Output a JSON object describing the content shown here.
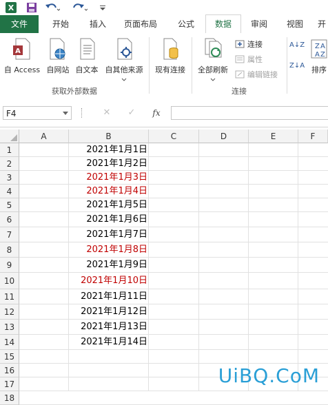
{
  "quick_access": {
    "excel_icon": "excel-logo-icon",
    "save_icon": "save-icon",
    "undo_icon": "undo-icon",
    "redo_icon": "redo-icon",
    "customize_icon": "customize-qat-icon"
  },
  "tabs": {
    "file": "文件",
    "home": "开始",
    "insert": "插入",
    "page_layout": "页面布局",
    "formulas": "公式",
    "data": "数据",
    "review": "审阅",
    "view": "视图",
    "more": "开"
  },
  "ribbon": {
    "from_access": "自 Access",
    "from_web": "自网站",
    "from_text": "自文本",
    "from_other": "自其他来源",
    "existing_connections": "现有连接",
    "refresh_all": "全部刷新",
    "connections": "连接",
    "properties": "属性",
    "edit_links": "编辑链接",
    "sort": "排序",
    "group_external": "获取外部数据",
    "group_connections": "连接",
    "sort_az": "A↓Z",
    "sort_za": "Z↓A"
  },
  "formula_bar": {
    "name_box": "F4",
    "cancel": "✕",
    "enter": "✓",
    "fx": "fx",
    "value": ""
  },
  "grid": {
    "columns": [
      "A",
      "B",
      "C",
      "D",
      "E",
      "F"
    ],
    "rows": [
      "1",
      "2",
      "3",
      "4",
      "5",
      "6",
      "7",
      "8",
      "9",
      "10",
      "11",
      "12",
      "13",
      "14",
      "15",
      "16",
      "17",
      "18"
    ],
    "cells": [
      {
        "text": "2021年1月1日",
        "color": "#000000"
      },
      {
        "text": "2021年1月2日",
        "color": "#000000"
      },
      {
        "text": "2021年1月3日",
        "color": "#c00000"
      },
      {
        "text": "2021年1月4日",
        "color": "#c00000"
      },
      {
        "text": "2021年1月5日",
        "color": "#000000"
      },
      {
        "text": "2021年1月6日",
        "color": "#000000"
      },
      {
        "text": "2021年1月7日",
        "color": "#000000"
      },
      {
        "text": "2021年1月8日",
        "color": "#c00000"
      },
      {
        "text": "2021年1月9日",
        "color": "#000000"
      },
      {
        "text": "2021年1月10日",
        "color": "#c00000"
      },
      {
        "text": "2021年1月11日",
        "color": "#000000"
      },
      {
        "text": "2021年1月12日",
        "color": "#000000"
      },
      {
        "text": "2021年1月13日",
        "color": "#000000"
      },
      {
        "text": "2021年1月14日",
        "color": "#000000"
      }
    ]
  },
  "watermark": "UiBQ.CoM",
  "colors": {
    "excel_green": "#217346",
    "red_date": "#c00000",
    "watermark": "#2a9fd6"
  }
}
